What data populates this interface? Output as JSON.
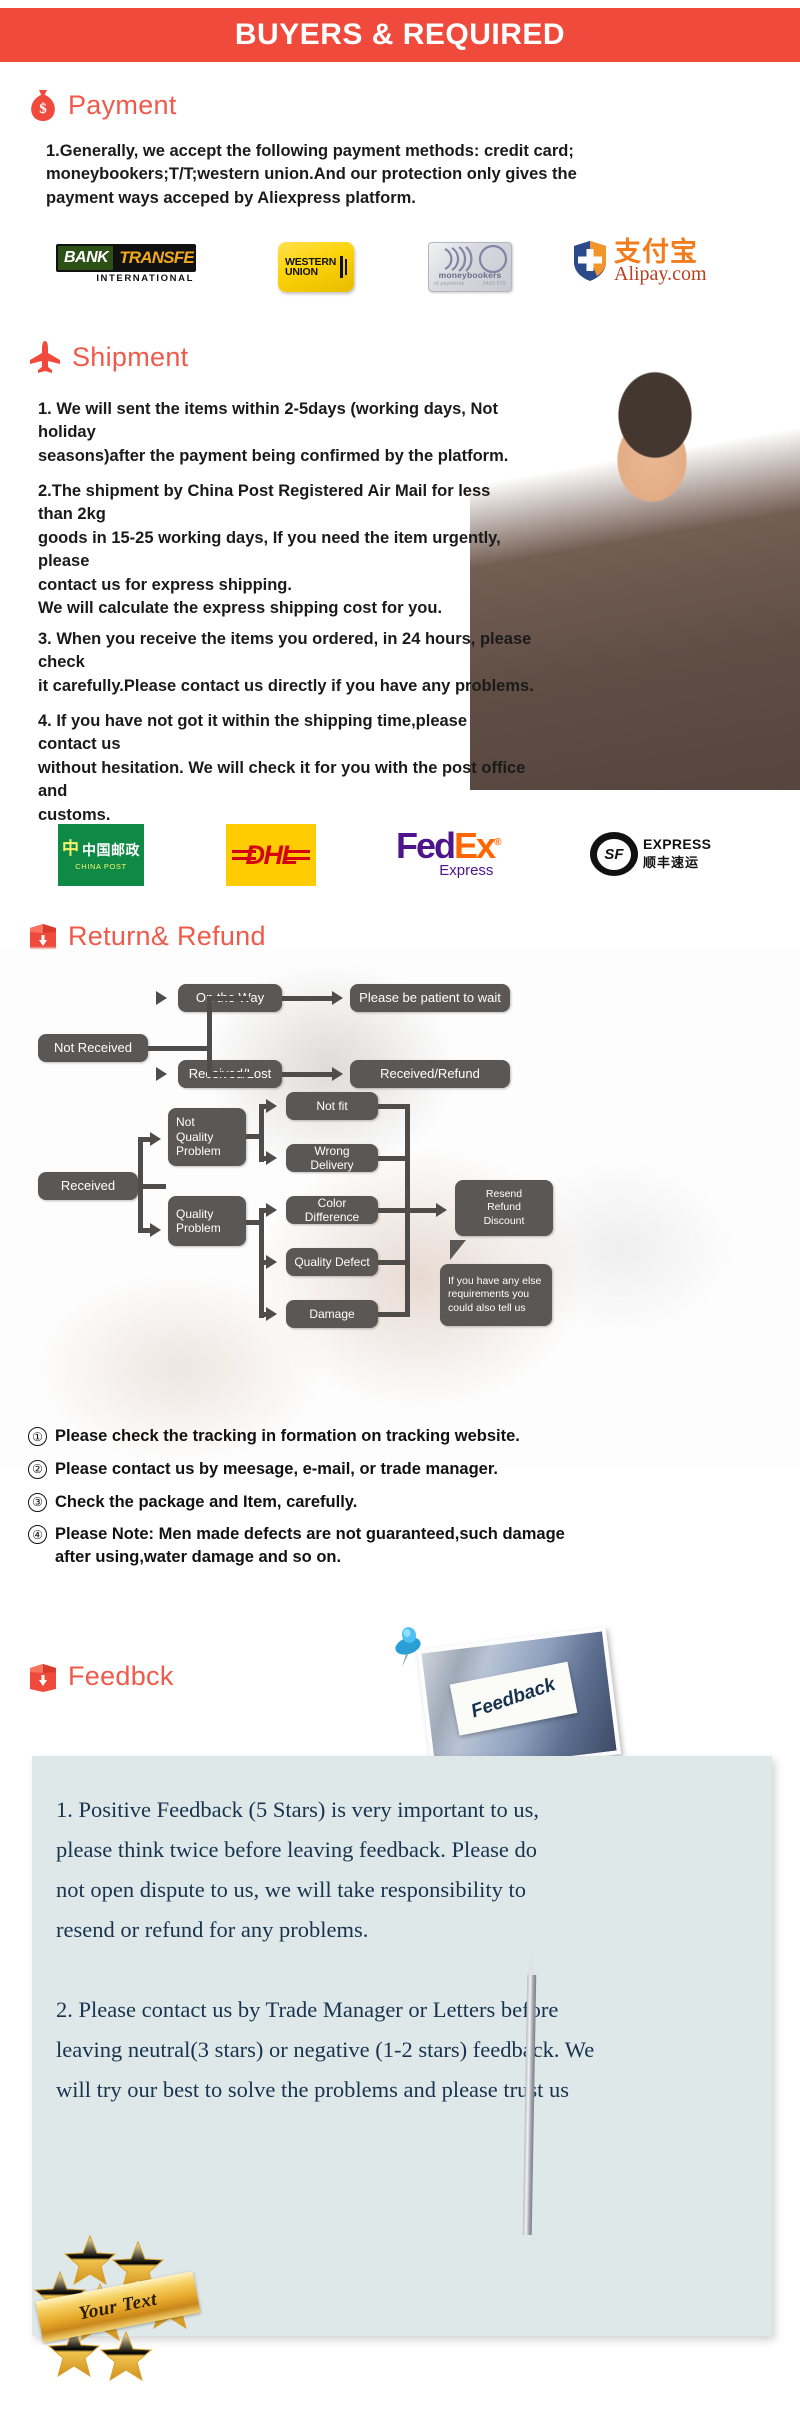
{
  "banner": {
    "title": "BUYERS & REQUIRED",
    "bg": "#ef4a3c",
    "text_color": "#ffffff"
  },
  "accent_color": "#ef5a4a",
  "sections": {
    "payment": {
      "icon": "money-bag-icon",
      "heading": "Payment",
      "body": "1.Generally, we accept the following payment methods: credit card;\nmoneybookers;T/T;western union.And our protection only gives the\npayment ways acceped by Aliexpress platform.",
      "logos": [
        {
          "name": "bank-transfer-logo",
          "primary": "BANK",
          "secondary": "TRANSFER",
          "tagline": "INTERNATIONAL"
        },
        {
          "name": "western-union-logo",
          "line1": "WESTERN",
          "line2": "UNION"
        },
        {
          "name": "moneybookers-logo",
          "label": "moneybookers",
          "micro_left": "of payments",
          "micro_right": "3465 079"
        },
        {
          "name": "alipay-logo",
          "chinese": "支付宝",
          "latin": "Alipay.com"
        }
      ]
    },
    "shipment": {
      "icon": "airplane-icon",
      "heading": "Shipment",
      "paragraphs": [
        "1. We will sent the items within 2-5days (working days, Not holiday\nseasons)after the payment being confirmed by the platform.",
        "2.The shipment by China Post Registered Air Mail for less than  2kg\ngoods in 15-25 working days, If  you need the item urgently, please\ncontact us for express shipping.\nWe will calculate the express shipping cost for you.",
        "3. When you receive the items you ordered, in 24 hours, please check\n it carefully.Please contact us directly if you have any problems.",
        "4. If you have not got it within the shipping time,please contact us\nwithout hesitation. We will check it for you with the post office and\ncustoms."
      ],
      "logos": [
        {
          "name": "china-post-logo",
          "chinese": "中国邮政",
          "english": "CHINA POST"
        },
        {
          "name": "dhl-logo",
          "text": "DHL"
        },
        {
          "name": "fedex-logo",
          "part1": "Fed",
          "part2": "Ex",
          "registered": "®",
          "sub": "Express"
        },
        {
          "name": "sf-express-logo",
          "mark": "SF",
          "english": "EXPRESS",
          "chinese": "顺丰速运"
        }
      ]
    },
    "return_refund": {
      "icon": "return-box-icon",
      "heading": "Return& Refund",
      "flow_nodes": [
        {
          "id": "not-received",
          "label": "Not Received"
        },
        {
          "id": "on-the-way",
          "label": "On the Way"
        },
        {
          "id": "please-be-patient",
          "label": "Please be patient to wait"
        },
        {
          "id": "received-lost",
          "label": "Received/Lost"
        },
        {
          "id": "received-refund",
          "label": "Received/Refund"
        },
        {
          "id": "received",
          "label": "Received"
        },
        {
          "id": "not-quality-problem",
          "label": "Not\nQuality\nProblem"
        },
        {
          "id": "quality-problem",
          "label": "Quality\nProblem"
        },
        {
          "id": "not-fit",
          "label": "Not fit"
        },
        {
          "id": "wrong-delivery",
          "label": "Wrong Delivery"
        },
        {
          "id": "color-difference",
          "label": "Color Difference"
        },
        {
          "id": "quality-defect",
          "label": "Quality Defect"
        },
        {
          "id": "damage",
          "label": "Damage"
        },
        {
          "id": "resend-refund-discount",
          "label": "Resend\nRefund\nDiscount"
        },
        {
          "id": "callout-note",
          "label": "If you have any else\nrequirements you\ncould also tell us"
        }
      ],
      "notes": [
        {
          "marker": "①",
          "text": "Please check the tracking in formation on tracking website."
        },
        {
          "marker": "②",
          "text": "Please contact us by meesage, e-mail, or trade manager."
        },
        {
          "marker": "③",
          "text": "Check the package and Item, carefully."
        },
        {
          "marker": "④",
          "text": "Please Note: Men made defects  are not guaranteed,such damage\nafter using,water damage and so on."
        }
      ]
    },
    "feedback": {
      "icon": "return-box-icon",
      "heading": "Feedbck",
      "photo_sign_text": "Feedback",
      "body": "1. Positive Feedback (5 Stars) is very important to us,\nplease think twice before leaving feedback. Please do\nnot open dispute to us,   we will take responsibility to\nresend or refund for any problems.\n\n2. Please contact us by Trade Manager or Letters before\nleaving neutral(3 stars) or negative (1-2 stars) feedback. We\nwill try our best to solve the problems and please trust us",
      "badge_text": "Your Text"
    }
  }
}
